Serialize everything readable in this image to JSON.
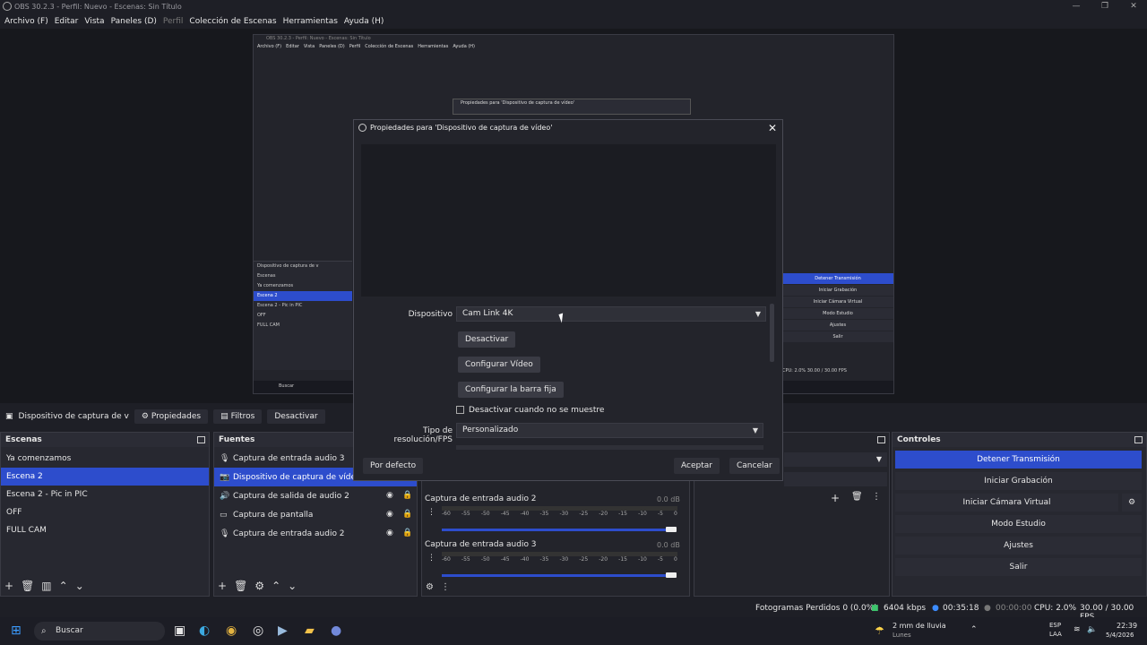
{
  "window": {
    "title": "OBS 30.2.3 - Perfil: Nuevo - Escenas: Sin Título",
    "min": "—",
    "max": "❐",
    "close": "✕"
  },
  "menu": [
    "Archivo (F)",
    "Editar",
    "Vista",
    "Paneles (D)",
    "Perfil",
    "Colección de Escenas",
    "Herramientas",
    "Ayuda (H)"
  ],
  "nested": {
    "title": "OBS 30.2.3 - Perfil: Nuevo - Escenas: Sin Título",
    "menu": [
      "Archivo (F)",
      "Editar",
      "Vista",
      "Paneles (D)",
      "Perfil",
      "Colección de Escenas",
      "Herramientas",
      "Ayuda (H)"
    ],
    "dialog_title": "Propiedades para 'Dispositivo de captura de vídeo'",
    "tab": "Dispositivo de captura de v",
    "scenes_header": "Escenas",
    "scenes": [
      "Ya comenzamos",
      "Escena 2",
      "Escena 2 - Pic in PIC",
      "OFF",
      "FULL CAM"
    ],
    "controls": [
      "Detener Transmisión",
      "Iniciar Grabación",
      "Iniciar Cámara Virtual",
      "Modo Estudio",
      "Ajustes",
      "Salir"
    ],
    "status": "CPU: 2.0%   30.00 / 30.00 FPS",
    "search": "Buscar"
  },
  "source_toolbar": {
    "current_source": "Dispositivo de captura de v",
    "properties": "Propiedades",
    "filters": "Filtros",
    "deactivate": "Desactivar"
  },
  "scenes": {
    "header": "Escenas",
    "items": [
      "Ya comenzamos",
      "Escena 2",
      "Escena 2 - Pic in PIC",
      "OFF",
      "FULL CAM"
    ],
    "selected": 1
  },
  "sources": {
    "header": "Fuentes",
    "items": [
      {
        "name": "Captura de entrada audio 3",
        "icon": "mic-icon"
      },
      {
        "name": "Dispositivo de captura de vídeo",
        "icon": "camera-icon"
      },
      {
        "name": "Captura de salida de audio 2",
        "icon": "speaker-icon"
      },
      {
        "name": "Captura de pantalla",
        "icon": "monitor-icon"
      },
      {
        "name": "Captura de entrada audio 2",
        "icon": "mic-icon"
      }
    ],
    "selected": 1
  },
  "mixer": {
    "channels": [
      {
        "name": "Captura de entrada audio 2",
        "db": "0.0 dB"
      },
      {
        "name": "Captura de entrada audio 3",
        "db": "0.0 dB"
      }
    ],
    "ticks": [
      "-60",
      "-55",
      "-50",
      "-45",
      "-40",
      "-35",
      "-30",
      "-25",
      "-20",
      "-15",
      "-10",
      "-5",
      "0"
    ]
  },
  "controls": {
    "header": "Controles",
    "buttons": [
      "Detener Transmisión",
      "Iniciar Grabación",
      "Iniciar Cámara Virtual",
      "Modo Estudio",
      "Ajustes",
      "Salir"
    ],
    "active_index": 0
  },
  "dialog": {
    "title": "Propiedades para 'Dispositivo de captura de vídeo'",
    "device_label": "Dispositivo",
    "device_value": "Cam Link 4K",
    "btn_deactivate": "Desactivar",
    "btn_config_video": "Configurar Vídeo",
    "btn_config_bar": "Configurar la barra fija",
    "checkbox_label": "Desactivar cuando no se muestre",
    "res_label": "Tipo de resolución/FPS",
    "res_value": "Personalizado",
    "defaults": "Por defecto",
    "accept": "Aceptar",
    "cancel": "Cancelar"
  },
  "status": {
    "dropped": "Fotogramas Perdidos 0 (0.0%)",
    "kbps": "6404 kbps",
    "stream_time": "00:35:18",
    "rec_time": "00:00:00",
    "cpu": "CPU: 2.0%",
    "fps": "30.00 / 30.00 FPS"
  },
  "taskbar": {
    "search": "Buscar",
    "weather": "2 mm de lluvia",
    "weather_sub": "Lunes",
    "lang": "ESP",
    "lang_sub": "LAA",
    "time": "22:39",
    "date": "5/4/2026"
  },
  "colors": {
    "accent": "#2d4dcc",
    "bg": "#1e1f26",
    "panel": "#272830"
  }
}
